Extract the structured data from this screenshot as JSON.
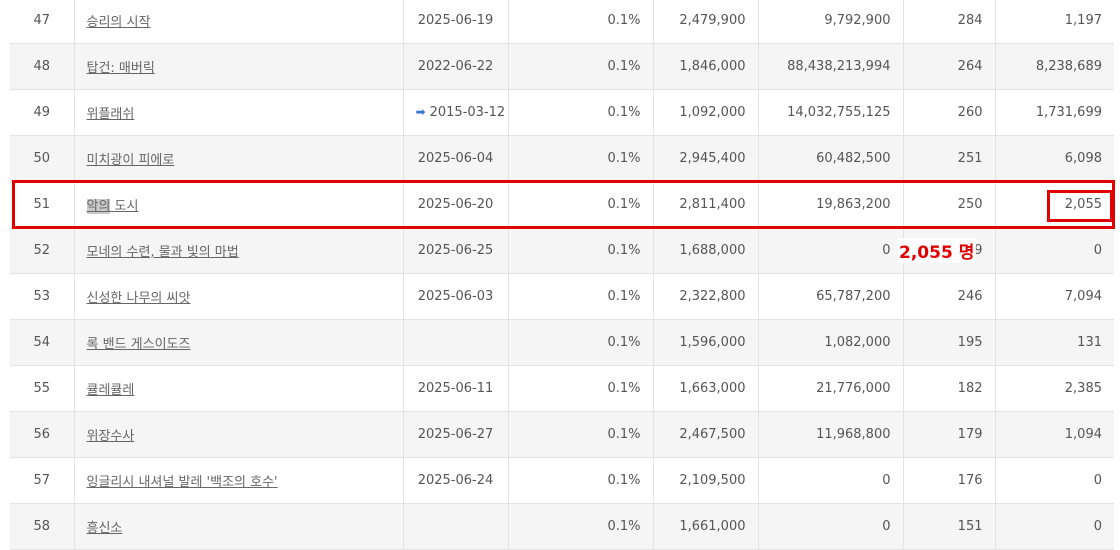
{
  "rows": [
    {
      "rank": "47",
      "title": "승리의 시작",
      "date": "2025-06-19",
      "share": "0.1%",
      "price": "2,479,900",
      "sales": "9,792,900",
      "shows": "284",
      "audience": "1,197"
    },
    {
      "rank": "48",
      "title": "탑건: 매버릭",
      "date": "2022-06-22",
      "share": "0.1%",
      "price": "1,846,000",
      "sales": "88,438,213,994",
      "shows": "264",
      "audience": "8,238,689"
    },
    {
      "rank": "49",
      "title": "위플래쉬",
      "date": "2015-03-12",
      "share": "0.1%",
      "price": "1,092,000",
      "sales": "14,032,755,125",
      "shows": "260",
      "audience": "1,731,699"
    },
    {
      "rank": "50",
      "title": "미치광이 피에로",
      "date": "2025-06-04",
      "share": "0.1%",
      "price": "2,945,400",
      "sales": "60,482,500",
      "shows": "251",
      "audience": "6,098"
    },
    {
      "rank": "51",
      "title_hl": "악의",
      "title_rest": " 도시",
      "date": "2025-06-20",
      "share": "0.1%",
      "price": "2,811,400",
      "sales": "19,863,200",
      "shows": "250",
      "audience": "2,055"
    },
    {
      "rank": "52",
      "title": "모네의 수련, 물과 빛의 마법",
      "date": "2025-06-25",
      "share": "0.1%",
      "price": "1,688,000",
      "sales": "0",
      "shows": "249",
      "audience": "0"
    },
    {
      "rank": "53",
      "title": "신성한 나무의 씨앗",
      "date": "2025-06-03",
      "share": "0.1%",
      "price": "2,322,800",
      "sales": "65,787,200",
      "shows": "246",
      "audience": "7,094"
    },
    {
      "rank": "54",
      "title": "록 밴드 게스이도즈",
      "date": "",
      "share": "0.1%",
      "price": "1,596,000",
      "sales": "1,082,000",
      "shows": "195",
      "audience": "131"
    },
    {
      "rank": "55",
      "title": "큘레큘레",
      "date": "2025-06-11",
      "share": "0.1%",
      "price": "1,663,000",
      "sales": "21,776,000",
      "shows": "182",
      "audience": "2,385"
    },
    {
      "rank": "56",
      "title": "위장수사",
      "date": "2025-06-27",
      "share": "0.1%",
      "price": "2,467,500",
      "sales": "11,968,800",
      "shows": "179",
      "audience": "1,094"
    },
    {
      "rank": "57",
      "title": "잉글리시 내셔널 발레 '백조의 호수'",
      "date": "2025-06-24",
      "share": "0.1%",
      "price": "2,109,500",
      "sales": "0",
      "shows": "176",
      "audience": "0"
    },
    {
      "rank": "58",
      "title": "흥신소",
      "date": "",
      "share": "0.1%",
      "price": "1,661,000",
      "sales": "0",
      "shows": "151",
      "audience": "0"
    }
  ],
  "annotation": {
    "text": "2,055 명"
  },
  "colors": {
    "highlight": "#e00000",
    "rerelease_icon": "#3a76d8"
  },
  "icons": {
    "rerelease": "arrow-right-icon"
  }
}
